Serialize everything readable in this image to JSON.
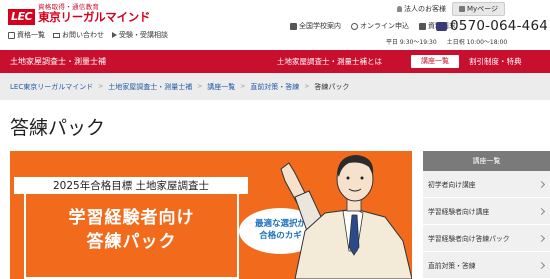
{
  "header": {
    "tagline": "資格取得・通信教育",
    "logo_mark": "LEC",
    "logo_text": "東京リーガルマインド",
    "sub_links": [
      "資格一覧",
      "お問い合わせ",
      "受験・受講相談"
    ],
    "corp_link": "法人のお客様",
    "mypage": "Myページ",
    "util_links": [
      "全国学校案内",
      "オンライン申込",
      "資料請求"
    ],
    "phone": "0570-064-464",
    "hours": [
      "平日 9:30〜19:30",
      "土日祝 10:00〜18:00"
    ]
  },
  "rednav": {
    "title": "土地家屋調査士・測量士補",
    "question": "土地家屋調査士・測量士補とは",
    "course_button": "講座一覧",
    "discount": "割引制度・特典"
  },
  "breadcrumb": [
    "LEC東京リーガルマインド",
    "土地家屋調査士・測量士補",
    "講座一覧",
    "直前対策・答練",
    "答練パック"
  ],
  "page_title": "答練パック",
  "banner": {
    "line1": "2025年合格目標 土地家屋調査士",
    "line2": "学習経験者向け",
    "line3": "答練パック",
    "bubble_line1": "最適な選択が",
    "bubble_line2": "合格のカギ",
    "bg_color": "#f26b1d"
  },
  "sidebar": {
    "heading": "講座一覧",
    "items": [
      "初学者向け講座",
      "学習経験者向け講座",
      "学習経験者向け答練パック",
      "直前対策・答練"
    ]
  }
}
